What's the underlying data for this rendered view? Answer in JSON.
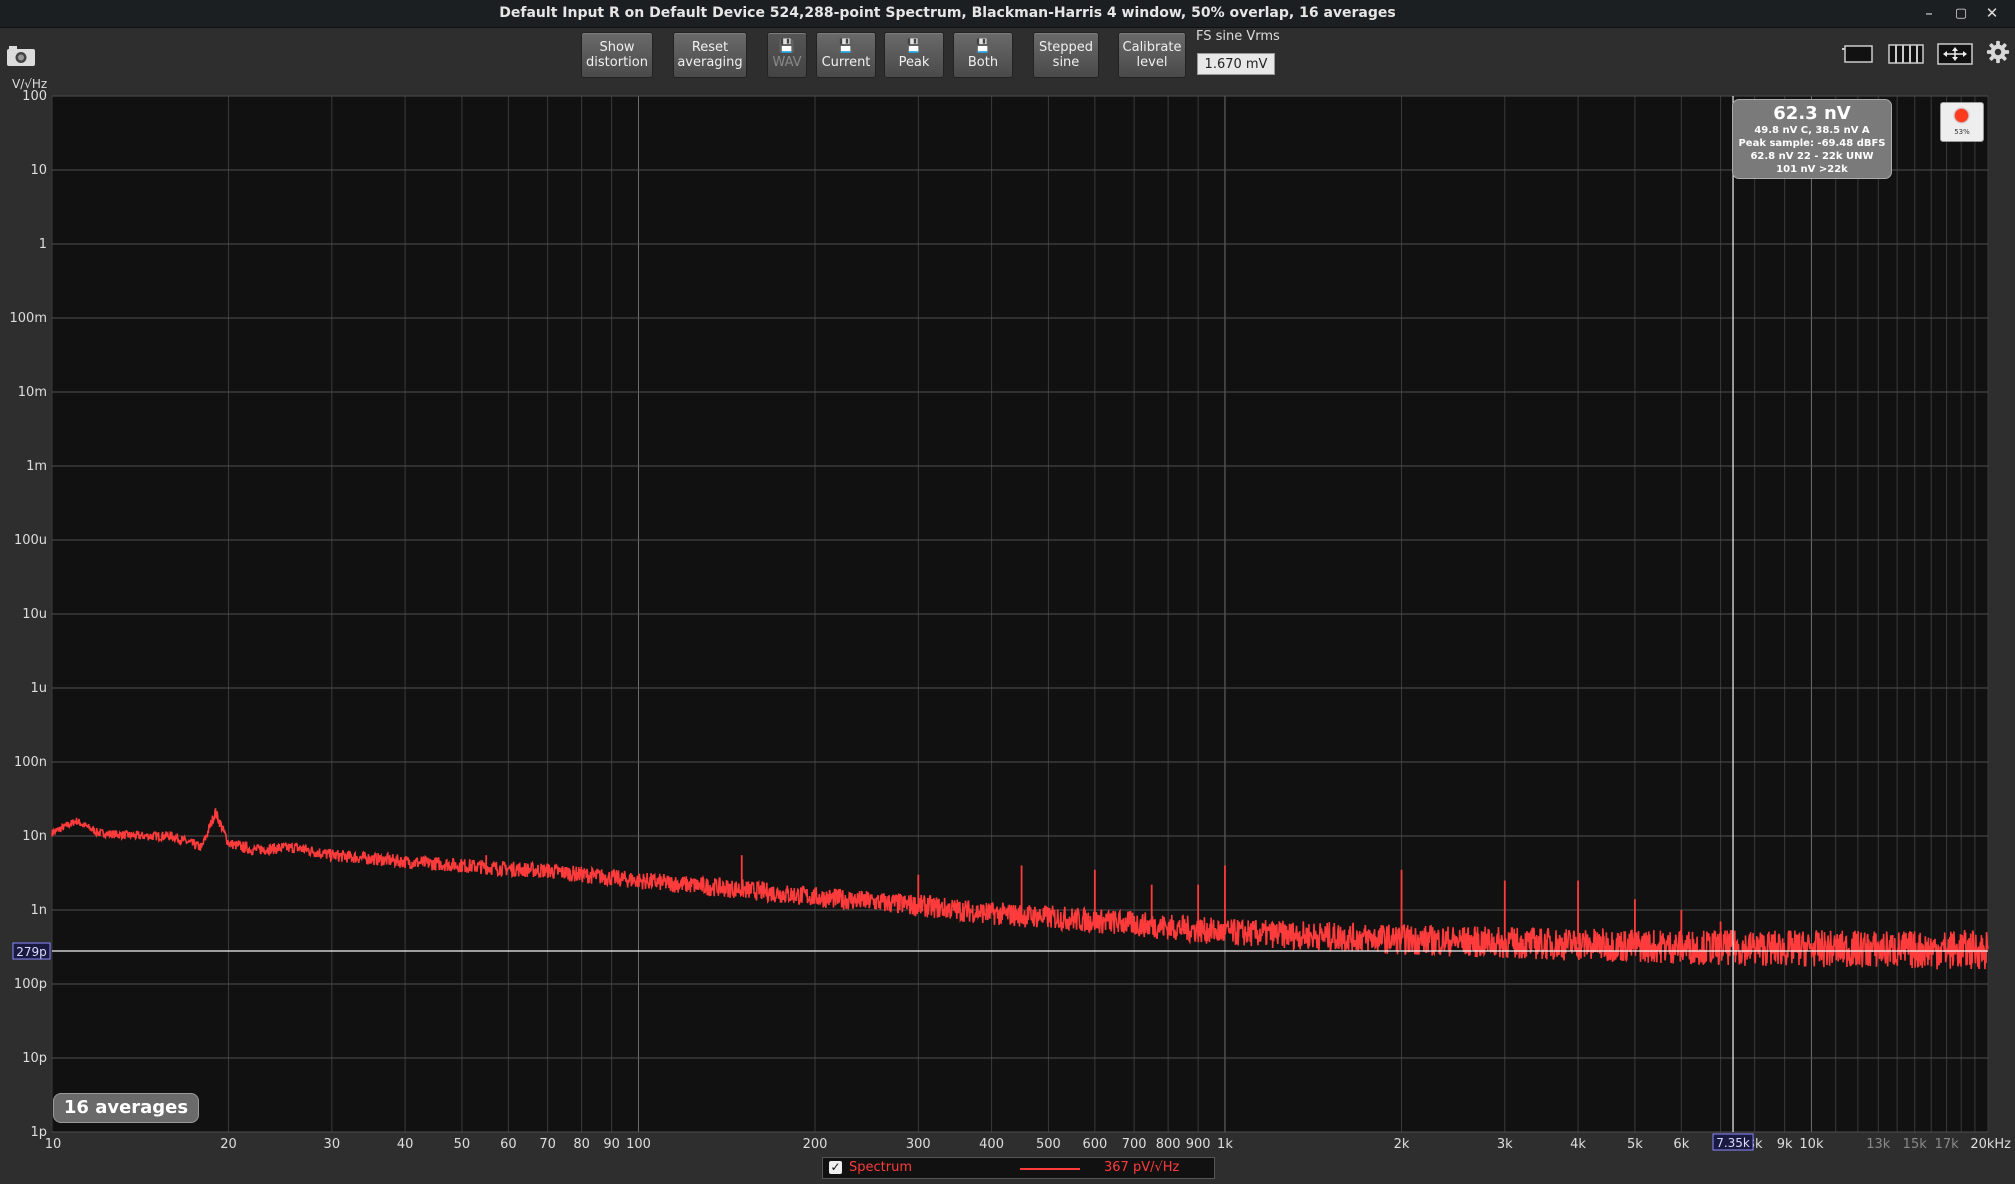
{
  "window": {
    "title": "Default Input R on Default Device 524,288-point Spectrum, Blackman-Harris 4 window, 50% overlap, 16 averages",
    "minimize": "–",
    "maximize": "▢",
    "close": "✕"
  },
  "toolbar": {
    "show_distortion": "Show\ndistortion",
    "reset_averaging": "Reset\naveraging",
    "wav": "WAV",
    "current": "Current",
    "peak": "Peak",
    "both": "Both",
    "stepped_sine": "Stepped\nsine",
    "calibrate_level": "Calibrate\nlevel",
    "fs_label": "FS sine Vrms",
    "fs_value": "1.670 mV"
  },
  "icons": {
    "camera": "camera-icon",
    "save": "floppy-icon",
    "single_view": "single-view-icon",
    "bars_view": "bars-view-icon",
    "fit": "fit-arrows-icon",
    "settings": "gear-icon"
  },
  "chart_data": {
    "type": "line",
    "title": "",
    "ylabel": "V/√Hz",
    "xlabel": "",
    "x_scale": "log",
    "y_scale": "log",
    "xlim": [
      10,
      20000
    ],
    "ylim": [
      1e-12,
      100
    ],
    "grid": true,
    "y_ticks": [
      {
        "v": 100,
        "label": "100"
      },
      {
        "v": 10,
        "label": "10"
      },
      {
        "v": 1,
        "label": "1"
      },
      {
        "v": 0.1,
        "label": "100m"
      },
      {
        "v": 0.01,
        "label": "10m"
      },
      {
        "v": 0.001,
        "label": "1m"
      },
      {
        "v": 0.0001,
        "label": "100u"
      },
      {
        "v": 1e-05,
        "label": "10u"
      },
      {
        "v": 1e-06,
        "label": "1u"
      },
      {
        "v": 1e-07,
        "label": "100n"
      },
      {
        "v": 1e-08,
        "label": "10n"
      },
      {
        "v": 1e-09,
        "label": "1n"
      },
      {
        "v": 1e-10,
        "label": "100p"
      },
      {
        "v": 1e-11,
        "label": "10p"
      },
      {
        "v": 1e-12,
        "label": "1p"
      }
    ],
    "x_ticks": [
      {
        "v": 10,
        "label": "10"
      },
      {
        "v": 20,
        "label": "20"
      },
      {
        "v": 30,
        "label": "30"
      },
      {
        "v": 40,
        "label": "40"
      },
      {
        "v": 50,
        "label": "50"
      },
      {
        "v": 60,
        "label": "60"
      },
      {
        "v": 70,
        "label": "70"
      },
      {
        "v": 80,
        "label": "80"
      },
      {
        "v": 90,
        "label": "90"
      },
      {
        "v": 100,
        "label": "100"
      },
      {
        "v": 200,
        "label": "200"
      },
      {
        "v": 300,
        "label": "300"
      },
      {
        "v": 400,
        "label": "400"
      },
      {
        "v": 500,
        "label": "500"
      },
      {
        "v": 600,
        "label": "600"
      },
      {
        "v": 700,
        "label": "700"
      },
      {
        "v": 800,
        "label": "800"
      },
      {
        "v": 900,
        "label": "900"
      },
      {
        "v": 1000,
        "label": "1k"
      },
      {
        "v": 2000,
        "label": "2k"
      },
      {
        "v": 3000,
        "label": "3k"
      },
      {
        "v": 4000,
        "label": "4k"
      },
      {
        "v": 5000,
        "label": "5k"
      },
      {
        "v": 6000,
        "label": "6k"
      },
      {
        "v": 8000,
        "label": "8k"
      },
      {
        "v": 9000,
        "label": "9k"
      },
      {
        "v": 10000,
        "label": "10k"
      },
      {
        "v": 13000,
        "label": "13k",
        "dim": true
      },
      {
        "v": 15000,
        "label": "15k",
        "dim": true
      },
      {
        "v": 17000,
        "label": "17k",
        "dim": true
      },
      {
        "v": 20000,
        "label": "20kHz"
      }
    ],
    "series": [
      {
        "name": "Spectrum",
        "color": "#ff3b3b",
        "points": [
          [
            10,
            1.1e-08
          ],
          [
            11,
            1.6e-08
          ],
          [
            12,
            1.1e-08
          ],
          [
            14,
            1e-08
          ],
          [
            16,
            1e-08
          ],
          [
            18,
            7e-09
          ],
          [
            19,
            2.1e-08
          ],
          [
            20,
            8e-09
          ],
          [
            22,
            6.5e-09
          ],
          [
            26,
            7e-09
          ],
          [
            30,
            5.5e-09
          ],
          [
            40,
            4.5e-09
          ],
          [
            50,
            4e-09
          ],
          [
            60,
            3.6e-09
          ],
          [
            70,
            3.4e-09
          ],
          [
            80,
            3e-09
          ],
          [
            100,
            2.5e-09
          ],
          [
            150,
            1.9e-09
          ],
          [
            200,
            1.5e-09
          ],
          [
            300,
            1.15e-09
          ],
          [
            400,
            9e-10
          ],
          [
            500,
            8e-10
          ],
          [
            700,
            6.5e-10
          ],
          [
            1000,
            5e-10
          ],
          [
            1500,
            4.4e-10
          ],
          [
            2000,
            4e-10
          ],
          [
            3000,
            3.6e-10
          ],
          [
            5000,
            3.3e-10
          ],
          [
            7000,
            3.1e-10
          ],
          [
            10000,
            3e-10
          ],
          [
            15000,
            2.9e-10
          ],
          [
            20000,
            2.9e-10
          ]
        ],
        "peaks": [
          [
            55,
            5.5e-09
          ],
          [
            150,
            5.5e-09
          ],
          [
            300,
            3e-09
          ],
          [
            450,
            4e-09
          ],
          [
            600,
            3.5e-09
          ],
          [
            750,
            2.2e-09
          ],
          [
            900,
            2.2e-09
          ],
          [
            1000,
            4e-09
          ],
          [
            2000,
            3.5e-09
          ],
          [
            3000,
            2.5e-09
          ],
          [
            4000,
            2.5e-09
          ],
          [
            5000,
            1.4e-09
          ],
          [
            6000,
            1e-09
          ],
          [
            7000,
            7e-10
          ]
        ],
        "legend_value": "367 pV/√Hz"
      }
    ],
    "reference_line": {
      "value": 2.79e-10,
      "label": "279p"
    },
    "cursor": {
      "x": 7350,
      "label": "7.35k"
    }
  },
  "readout": {
    "main": "62.3 nV",
    "line1": "49.8 nV C, 38.5 nV A",
    "line2": "Peak sample: -69.48 dBFS",
    "line3": "62.8 nV 22 - 22k UNW",
    "line4": "101 nV >22k"
  },
  "meter": {
    "percent": "53%"
  },
  "averages_badge": "16 averages",
  "legend": {
    "series_name": "Spectrum",
    "value": "367 pV/√Hz",
    "checked": true
  }
}
